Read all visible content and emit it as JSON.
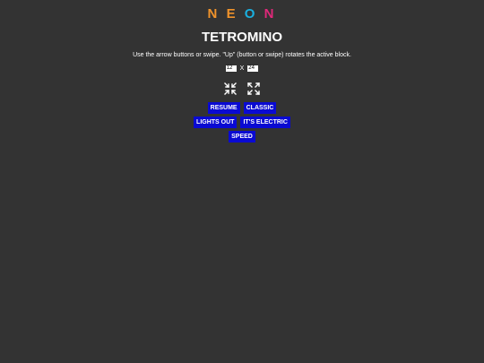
{
  "logo": {
    "letters": [
      {
        "char": "N",
        "color": "#f0932b"
      },
      {
        "char": "E",
        "color": "#f0932b"
      },
      {
        "char": "O",
        "color": "#1ab0e0"
      },
      {
        "char": "N",
        "color": "#e0287a"
      }
    ]
  },
  "title": "TETROMINO",
  "instructions": "Use the arrow buttons or swipe. \"Up\" (button or swipe) rotates the active block.",
  "grid_size": {
    "columns": "12",
    "separator": "X",
    "rows": "24"
  },
  "icons": {
    "shrink": "shrink-arrows-icon",
    "expand": "expand-arrows-icon"
  },
  "colors": {
    "background": "#333333",
    "button": "#0a0ad2",
    "text": "#ffffff"
  },
  "buttons": {
    "resume": "RESUME",
    "classic": "CLASSIC",
    "lights_out": "LIGHTS OUT",
    "its_electric": "IT'S ELECTRIC",
    "speed": "SPEED"
  }
}
